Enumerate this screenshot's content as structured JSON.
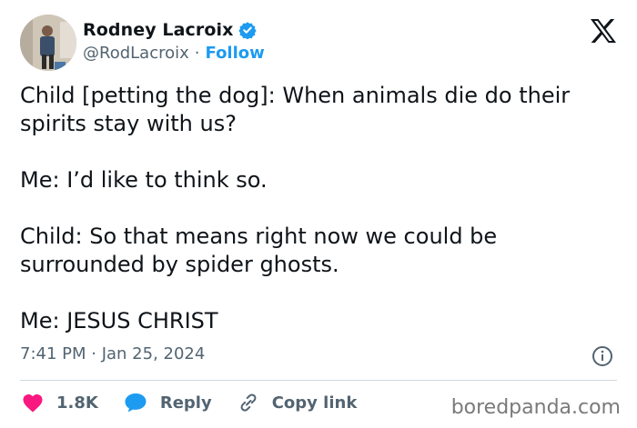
{
  "author": {
    "name": "Rodney Lacroix",
    "handle": "@RodLacroix",
    "separator": "·",
    "follow_label": "Follow"
  },
  "tweet": {
    "paragraphs": [
      "Child [petting the dog]: When animals die do their spirits stay with us?",
      "Me: I’d like to think so.",
      "Child: So that means right now we could be surrounded by spider ghosts.",
      "Me: JESUS CHRIST"
    ],
    "timestamp": "7:41 PM · Jan 25, 2024"
  },
  "actions": {
    "likes_count": "1.8K",
    "reply_label": "Reply",
    "copy_link_label": "Copy link"
  },
  "watermark": "boredpanda.com",
  "colors": {
    "like": "#f91880",
    "reply": "#1d9bf0",
    "link_accent": "#1d9bf0",
    "verified": "#1d9bf0",
    "secondary_text": "#536471"
  },
  "icons": [
    "verified-badge-icon",
    "x-logo-icon",
    "info-icon",
    "heart-icon",
    "reply-bubble-icon",
    "link-icon"
  ]
}
